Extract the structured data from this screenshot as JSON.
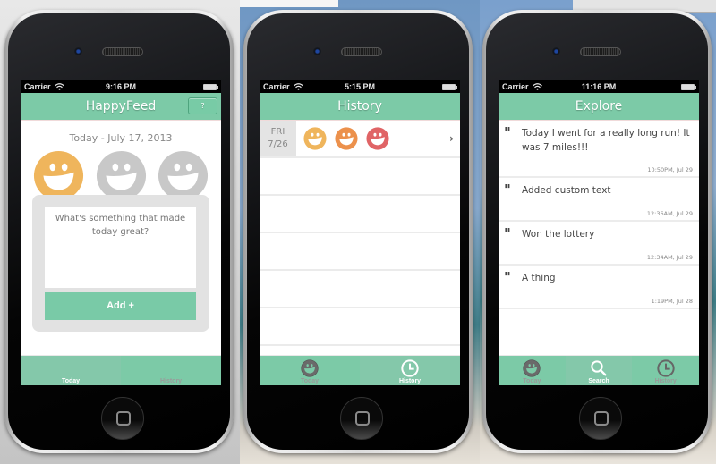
{
  "colors": {
    "brand_green": "#7ccaa7",
    "happy_yellow": "#efb55c",
    "happy_orange": "#ec914c",
    "happy_red": "#e06466",
    "inactive_gray": "#c8c8c8"
  },
  "phones": [
    {
      "status": {
        "carrier": "Carrier",
        "time": "9:16 PM"
      },
      "nav": {
        "title": "HappyFeed",
        "help_label": "?"
      },
      "today": {
        "date": "Today - July 17, 2013",
        "moods": [
          "happy-selected",
          "happy-unselected",
          "happy-unselected"
        ],
        "placeholder": "What's something that made today great?",
        "add_label": "Add +"
      },
      "tabs": [
        {
          "label": "Today",
          "active": true
        },
        {
          "label": "History",
          "active": false
        }
      ]
    },
    {
      "status": {
        "carrier": "Carrier",
        "time": "5:15 PM"
      },
      "nav": {
        "title": "History"
      },
      "history": [
        {
          "day": "FRI",
          "date": "7/26",
          "faces": [
            "yellow",
            "orange",
            "red"
          ]
        }
      ],
      "tabs": [
        {
          "label": "Today",
          "icon": "smiley-icon",
          "active": false
        },
        {
          "label": "History",
          "icon": "clock-icon",
          "active": true
        }
      ]
    },
    {
      "status": {
        "carrier": "Carrier",
        "time": "11:16 PM"
      },
      "nav": {
        "title": "Explore"
      },
      "feed": [
        {
          "text": "Today I went for a really long run! It was 7 miles!!!",
          "timestamp": "10:50PM, Jul 29"
        },
        {
          "text": "Added custom text",
          "timestamp": "12:36AM, Jul 29"
        },
        {
          "text": "Won the lottery",
          "timestamp": "12:34AM, Jul 29"
        },
        {
          "text": "A thing",
          "timestamp": "1:19PM, Jul 28"
        }
      ],
      "tabs": [
        {
          "label": "Today",
          "icon": "smiley-icon",
          "active": false
        },
        {
          "label": "Search",
          "icon": "search-icon",
          "active": true
        },
        {
          "label": "History",
          "icon": "clock-icon",
          "active": false
        }
      ]
    }
  ]
}
